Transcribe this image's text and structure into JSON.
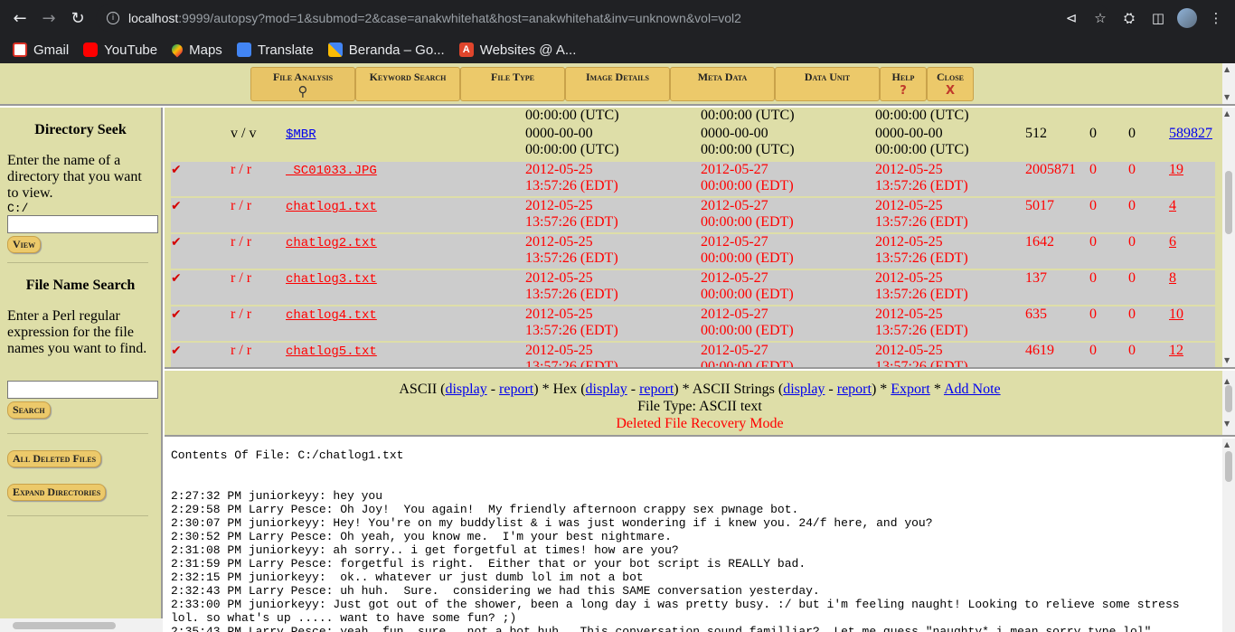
{
  "browser": {
    "url_host": "localhost",
    "url_rest": ":9999/autopsy?mod=1&submod=2&case=anakwhitehat&host=anakwhitehat&inv=unknown&vol=vol2",
    "bookmarks": [
      "Gmail",
      "YouTube",
      "Maps",
      "Translate",
      "Beranda – Go...",
      "Websites @ A..."
    ]
  },
  "tabs": [
    {
      "label": "File Analysis",
      "sub": "🔍"
    },
    {
      "label": "Keyword Search",
      "sub": ""
    },
    {
      "label": "File Type",
      "sub": ""
    },
    {
      "label": "Image Details",
      "sub": ""
    },
    {
      "label": "Meta Data",
      "sub": ""
    },
    {
      "label": "Data Unit",
      "sub": ""
    },
    {
      "label": "Help",
      "sub": "?"
    },
    {
      "label": "Close",
      "sub": "X"
    }
  ],
  "left": {
    "dir_title": "Directory Seek",
    "dir_text": "Enter the name of a directory that you want to view.",
    "dir_path": "C:/",
    "view_btn": "View",
    "fns_title": "File Name Search",
    "fns_text": "Enter a Perl regular expression for the file names you want to find.",
    "search_btn": "Search",
    "deleted_btn": "All Deleted Files",
    "expand_btn": "Expand Directories"
  },
  "files": {
    "partial_top": {
      "written": "00:00:00 (UTC)",
      "accessed": "00:00:00 (UTC)",
      "changed": "00:00:00 (UTC)"
    },
    "rows": [
      {
        "deleted": false,
        "type": "v / v",
        "name": "$MBR",
        "w1": "0000-00-00",
        "w2": "00:00:00 (UTC)",
        "a1": "0000-00-00",
        "a2": "00:00:00 (UTC)",
        "c1": "0000-00-00",
        "c2": "00:00:00 (UTC)",
        "size": "512",
        "uid": "0",
        "gid": "0",
        "meta": "589827"
      },
      {
        "deleted": true,
        "type": "r / r",
        "name": "_SC01033.JPG",
        "w1": "2012-05-25",
        "w2": "13:57:26 (EDT)",
        "a1": "2012-05-27",
        "a2": "00:00:00 (EDT)",
        "c1": "2012-05-25",
        "c2": "13:57:26 (EDT)",
        "size": "2005871",
        "uid": "0",
        "gid": "0",
        "meta": "19"
      },
      {
        "deleted": true,
        "type": "r / r",
        "name": "chatlog1.txt",
        "w1": "2012-05-25",
        "w2": "13:57:26 (EDT)",
        "a1": "2012-05-27",
        "a2": "00:00:00 (EDT)",
        "c1": "2012-05-25",
        "c2": "13:57:26 (EDT)",
        "size": "5017",
        "uid": "0",
        "gid": "0",
        "meta": "4"
      },
      {
        "deleted": true,
        "type": "r / r",
        "name": "chatlog2.txt",
        "w1": "2012-05-25",
        "w2": "13:57:26 (EDT)",
        "a1": "2012-05-27",
        "a2": "00:00:00 (EDT)",
        "c1": "2012-05-25",
        "c2": "13:57:26 (EDT)",
        "size": "1642",
        "uid": "0",
        "gid": "0",
        "meta": "6"
      },
      {
        "deleted": true,
        "type": "r / r",
        "name": "chatlog3.txt",
        "w1": "2012-05-25",
        "w2": "13:57:26 (EDT)",
        "a1": "2012-05-27",
        "a2": "00:00:00 (EDT)",
        "c1": "2012-05-25",
        "c2": "13:57:26 (EDT)",
        "size": "137",
        "uid": "0",
        "gid": "0",
        "meta": "8"
      },
      {
        "deleted": true,
        "type": "r / r",
        "name": "chatlog4.txt",
        "w1": "2012-05-25",
        "w2": "13:57:26 (EDT)",
        "a1": "2012-05-27",
        "a2": "00:00:00 (EDT)",
        "c1": "2012-05-25",
        "c2": "13:57:26 (EDT)",
        "size": "635",
        "uid": "0",
        "gid": "0",
        "meta": "10"
      },
      {
        "deleted": true,
        "type": "r / r",
        "name": "chatlog5.txt",
        "w1": "2012-05-25",
        "w2": "13:57:26 (EDT)",
        "a1": "2012-05-27",
        "a2": "00:00:00 (EDT)",
        "c1": "2012-05-25",
        "c2": "13:57:26 (EDT)",
        "size": "4619",
        "uid": "0",
        "gid": "0",
        "meta": "12"
      }
    ]
  },
  "viewer": {
    "ascii": "ASCII (",
    "display": "display",
    "dash": " - ",
    "report": "report",
    "hex": ") * Hex (",
    "strings": ") * ASCII Strings (",
    "sep": ") * ",
    "export": "Export",
    "star": " * ",
    "add_note": "Add Note",
    "file_type": "File Type: ASCII text",
    "recovery": "Deleted File Recovery Mode"
  },
  "content": {
    "title": "Contents Of File: C:/chatlog1.txt",
    "lines": [
      "2:27:32 PM juniorkeyy: hey you",
      "2:29:58 PM Larry Pesce: Oh Joy!  You again!  My friendly afternoon crappy sex pwnage bot.",
      "2:30:07 PM juniorkeyy: Hey! You're on my buddylist & i was just wondering if i knew you. 24/f here, and you?",
      "2:30:52 PM Larry Pesce: Oh yeah, you know me.  I'm your best nightmare.",
      "2:31:08 PM juniorkeyy: ah sorry.. i get forgetful at times! how are you?",
      "2:31:59 PM Larry Pesce: forgetful is right.  Either that or your bot script is REALLY bad.",
      "2:32:15 PM juniorkeyy:  ok.. whatever ur just dumb lol im not a bot",
      "2:32:43 PM Larry Pesce: uh huh.  Sure.  considering we had this SAME conversation yesterday.",
      "2:33:00 PM juniorkeyy: Just got out of the shower, been a long day i was pretty busy. :/ but i'm feeling naught! Looking to relieve some stress",
      "lol. so what's up ..... want to have some fun? ;)",
      "2:35:43 PM Larry Pesce: yeah, fun, sure.  not a bot huh.  This conversation sound familliar?  Let me guess \"naughty* i mean sorry type lol\""
    ]
  }
}
